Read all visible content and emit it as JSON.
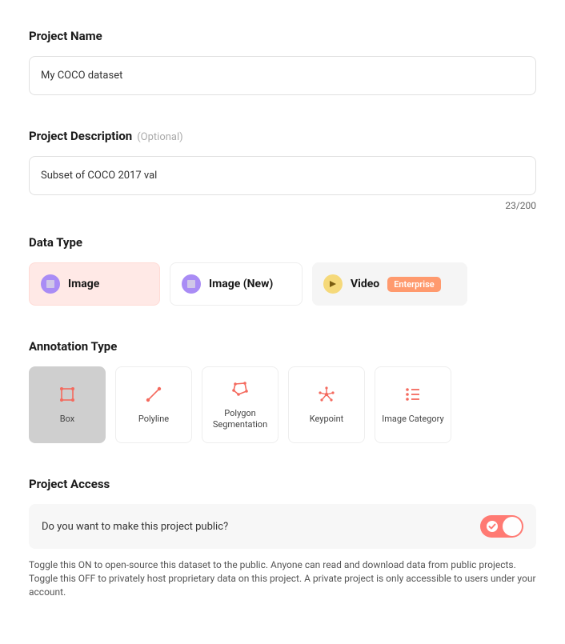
{
  "projectName": {
    "label": "Project Name",
    "value": "My COCO dataset"
  },
  "projectDescription": {
    "label": "Project Description",
    "optional": "(Optional)",
    "value": "Subset of COCO 2017 val",
    "counter": "23/200"
  },
  "dataType": {
    "label": "Data Type",
    "options": {
      "image": "Image",
      "imageNew": "Image (New)",
      "video": "Video",
      "videoBadge": "Enterprise"
    },
    "selected": "image"
  },
  "annotationType": {
    "label": "Annotation Type",
    "options": {
      "box": "Box",
      "polyline": "Polyline",
      "polygon": "Polygon Segmentation",
      "keypoint": "Keypoint",
      "category": "Image Category"
    },
    "selected": "box"
  },
  "projectAccess": {
    "label": "Project Access",
    "question": "Do you want to make this project public?",
    "enabled": true,
    "helpText": "Toggle this ON to open-source this dataset to the public. Anyone can read and download data from public projects. Toggle this OFF to privately host proprietary data on this project. A private project is only accessible to users under your account."
  }
}
